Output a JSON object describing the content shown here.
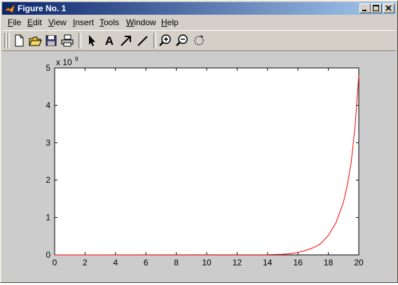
{
  "window": {
    "title": "Figure No. 1",
    "buttons": [
      "minimize",
      "maximize",
      "close"
    ]
  },
  "menubar": {
    "items": [
      {
        "accel": "F",
        "rest": "ile"
      },
      {
        "accel": "E",
        "rest": "dit"
      },
      {
        "accel": "V",
        "rest": "iew"
      },
      {
        "accel": "I",
        "rest": "nsert"
      },
      {
        "accel": "T",
        "rest": "ools"
      },
      {
        "accel": "W",
        "rest": "indow"
      },
      {
        "accel": "H",
        "rest": "elp"
      }
    ]
  },
  "toolbar": {
    "tools": [
      "new-file-icon",
      "open-folder-icon",
      "save-icon",
      "print-icon",
      "select-arrow-icon",
      "insert-text-icon",
      "insert-arrow-icon",
      "insert-line-icon",
      "zoom-in-icon",
      "zoom-out-icon",
      "rotate-3d-icon"
    ],
    "text_tool_glyph": "A"
  },
  "chart_data": {
    "type": "line",
    "exponent_label": "x 10",
    "exponent_power": "9",
    "xlim": [
      0,
      20
    ],
    "ylim": [
      0,
      5
    ],
    "xticks": [
      "0",
      "2",
      "4",
      "6",
      "8",
      "10",
      "12",
      "14",
      "16",
      "18",
      "20"
    ],
    "yticks": [
      "0",
      "1",
      "2",
      "3",
      "4",
      "5"
    ],
    "grid": false,
    "series": [
      {
        "color": "#ff0000",
        "x": [
          0,
          14,
          15,
          15.5,
          16,
          16.5,
          17,
          17.5,
          18,
          18.5,
          19,
          19.25,
          19.5,
          19.75,
          20
        ],
        "y": [
          0,
          0.004,
          0.016,
          0.032,
          0.065,
          0.12,
          0.19,
          0.3,
          0.52,
          0.86,
          1.42,
          1.87,
          2.46,
          3.4,
          4.8
        ]
      }
    ],
    "colors": {
      "axes_bg": "#ffffff",
      "figure_bg": "#cccccc",
      "axis": "#000000"
    }
  }
}
